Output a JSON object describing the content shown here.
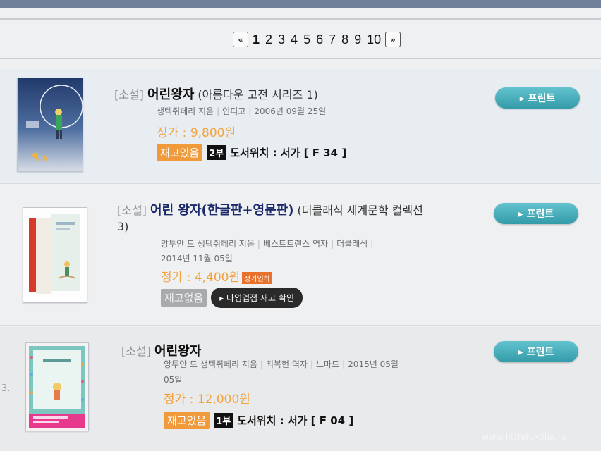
{
  "pager": {
    "prev_icon": "double-left-arrow-icon",
    "next_icon": "double-right-arrow-icon",
    "pages": [
      "1",
      "2",
      "3",
      "4",
      "5",
      "6",
      "7",
      "8",
      "9",
      "10"
    ],
    "current": "1"
  },
  "books": [
    {
      "category": "[소설]",
      "title": "어린왕자",
      "subtitle": "(아름다운 고전 시리즈 1)",
      "author": "생텍쥐페리 지음",
      "publisher": "인디고",
      "date": "2006년 09월 25일",
      "price": "정가 : 9,800원",
      "stock": "재고있음",
      "count": "2부",
      "location": "도서위치 : 서가 [ F 34 ]",
      "print_label": "▸ 프린트"
    },
    {
      "category": "[소설]",
      "title": "어린 왕자(한글판+영문판)",
      "subtitle": "(더클래식 세계문학 컬렉션",
      "subtitle2": "3)",
      "author": "앙투안 드 생텍쥐페리 지음",
      "translator": "베스트트랜스 역자",
      "publisher": "더클래식",
      "date": "2014년 11월 05일",
      "price": "정가 : 4,400원",
      "price_badge": "정가인하",
      "stock": "재고없음",
      "check_label": "▸ 타영업점 재고 확인",
      "print_label": "▸ 프린트"
    },
    {
      "category": "[소설]",
      "title": "어린왕자",
      "author": "앙투안 드 생텍쥐페리 지음",
      "translator": "최복현 역자",
      "publisher": "노마드",
      "date": "2015년 05월",
      "date2": "05일",
      "price": "정가 : 12,000원",
      "stock": "재고있음",
      "count": "1부",
      "location": "도서위치 : 서가 [ F 04 ]",
      "print_label": "▸ 프린트",
      "side_number": "3."
    }
  ],
  "watermark": "www.littlefoxlilia.ru",
  "colors": {
    "accent_teal": "#3aa6b2",
    "price_orange": "#f4a23b",
    "stock_orange": "#f09a3b",
    "stock_gray": "#a9aaac"
  }
}
